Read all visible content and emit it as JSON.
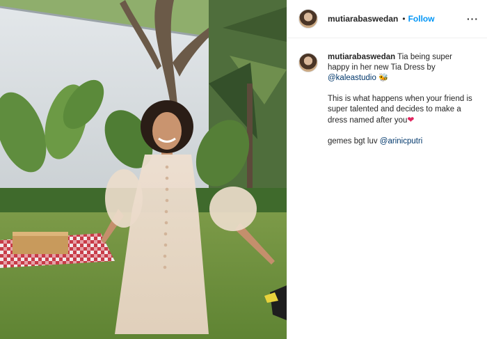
{
  "post": {
    "username": "mutiarabaswedan",
    "separator": "•",
    "follow_label": "Follow",
    "more_label": "···",
    "caption": {
      "username": "mutiarabaswedan",
      "line1_text": " Tia being super happy in her new Tia Dress by ",
      "mention1": "@kaleastudio",
      "emoji1": "🐝",
      "para2_text": "This is what happens when your friend is super talented and decides to make a dress named after you",
      "heart": "❤",
      "para3_text": "gemes bgt luv ",
      "mention2": "@arinicputri"
    }
  },
  "icons": {
    "more": "more-options-icon",
    "avatar": "profile-avatar"
  },
  "colors": {
    "follow": "#0095f6",
    "mention": "#00376b",
    "text": "#262626",
    "heart": "#e0245e"
  }
}
